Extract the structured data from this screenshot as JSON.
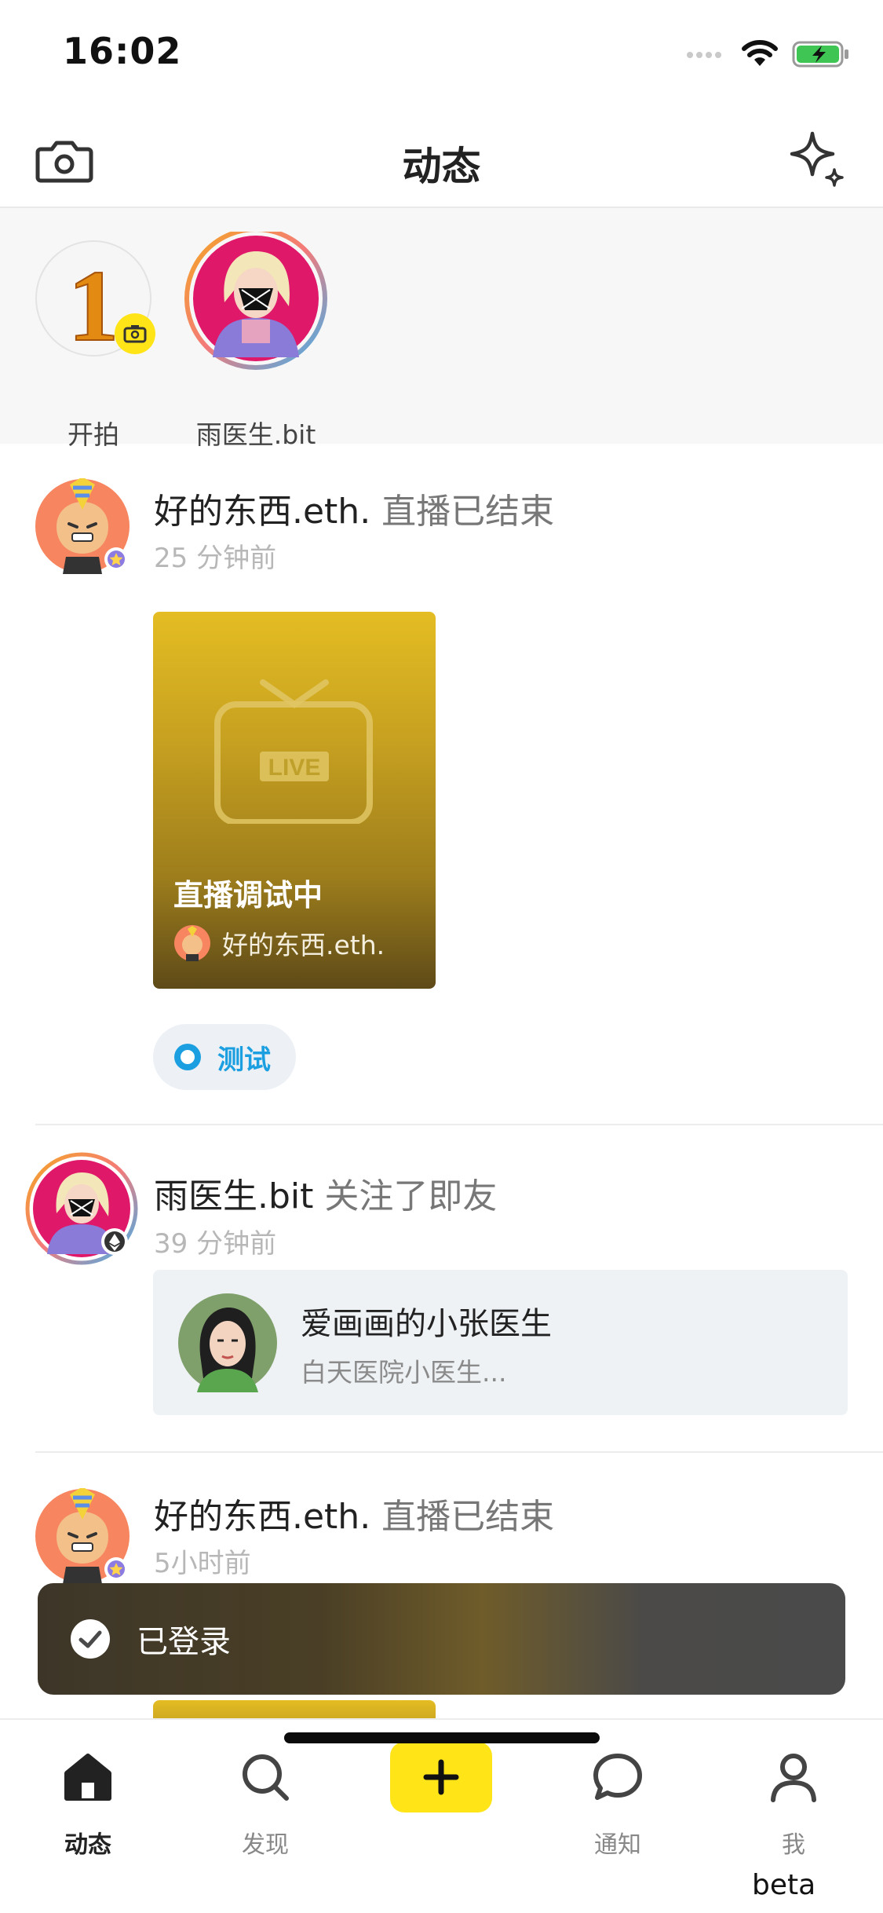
{
  "status_bar": {
    "time": "16:02"
  },
  "header": {
    "title": "动态"
  },
  "stories": [
    {
      "label": "开拍",
      "badge_digit": "1"
    },
    {
      "label": "雨医生.bit"
    }
  ],
  "feed": [
    {
      "user": "好的东西.eth.",
      "action": " 直播已结束",
      "time": "25 分钟前",
      "live_card": {
        "badge": "LIVE",
        "title": "直播调试中",
        "user": "好的东西.eth."
      },
      "tag": "测试"
    },
    {
      "user": "雨医生.bit",
      "action": " 关注了即友",
      "time": "39 分钟前",
      "follow_card": {
        "name": "爱画画的小张医生",
        "desc": "白天医院小医生..."
      }
    },
    {
      "user": "好的东西.eth.",
      "action": " 直播已结束",
      "time": "5小时前"
    }
  ],
  "toast": {
    "text": "已登录"
  },
  "tabbar": {
    "items": [
      {
        "label": "动态",
        "icon": "home-icon",
        "active": true
      },
      {
        "label": "发现",
        "icon": "search-icon"
      },
      {
        "label": "",
        "icon": "plus-icon"
      },
      {
        "label": "通知",
        "icon": "chat-bubble-icon"
      },
      {
        "label": "我",
        "icon": "person-icon"
      }
    ]
  },
  "footer": {
    "beta": "beta"
  },
  "colors": {
    "accent_yellow": "#ffe417",
    "tag_blue": "#1b9fe1",
    "toast_bg": "#4a4a4a"
  }
}
